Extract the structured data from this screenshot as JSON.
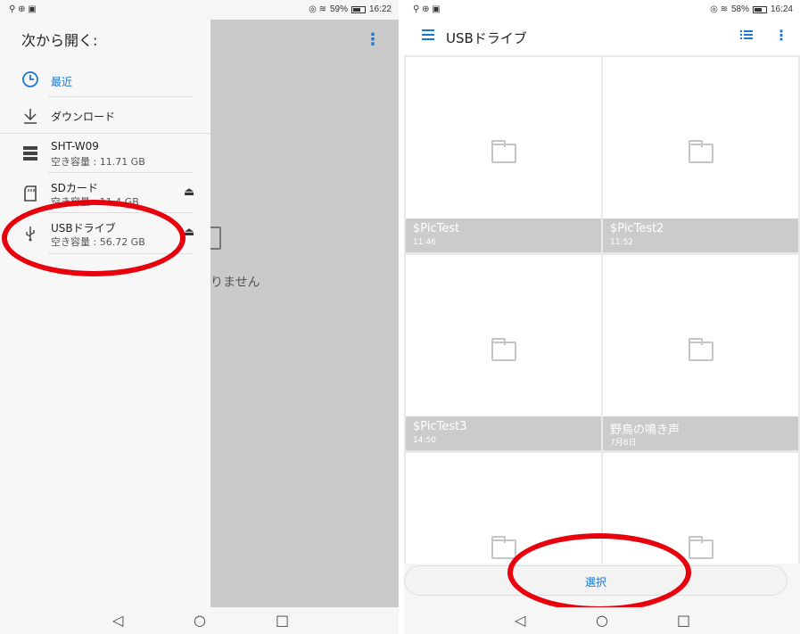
{
  "left_screen": {
    "status": {
      "left_icons": "⚲ ⊕ ▣",
      "right_icons": "◎ ≋",
      "battery": "59%",
      "battery_level": 0.59,
      "time": "16:22"
    },
    "background": {
      "text": "りません"
    },
    "drawer": {
      "title": "次から開く:",
      "items": [
        {
          "label": "最近",
          "icon": "clock-icon",
          "color": "#1976d2"
        },
        {
          "label": "ダウンロード",
          "icon": "download-icon"
        },
        {
          "label": "SHT-W09",
          "sub": "空き容量 : 11.71 GB",
          "icon": "storage-icon"
        },
        {
          "label": "SDカード",
          "sub": "空き容量 : 11.4 GB",
          "icon": "sdcard-icon",
          "eject": "⏏"
        },
        {
          "label": "USBドライブ",
          "sub": "空き容量 : 56.72 GB",
          "icon": "usb-icon",
          "eject": "⏏"
        }
      ]
    },
    "nav": {
      "back": "◁",
      "home": "○",
      "recent": "□"
    }
  },
  "right_screen": {
    "status": {
      "left_icons": "⚲ ⊕ ▣",
      "right_icons": "◎ ≋",
      "battery": "58%",
      "battery_level": 0.58,
      "time": "16:24"
    },
    "title": "USBドライブ",
    "folders": [
      {
        "name": "$PicTest",
        "time": "11:46"
      },
      {
        "name": "$PicTest2",
        "time": "11:52"
      },
      {
        "name": "$PicTest3",
        "time": "14:50"
      },
      {
        "name": "野鳥の鳴き声",
        "time": "7月8日"
      },
      {
        "name": "",
        "time": ""
      },
      {
        "name": "",
        "time": ""
      }
    ],
    "select_label": "選択",
    "nav": {
      "back": "◁",
      "home": "○",
      "recent": "□"
    }
  },
  "colors": {
    "accent": "#1976d2",
    "highlight": "#e8000c",
    "caption": "#cbcbcb"
  }
}
